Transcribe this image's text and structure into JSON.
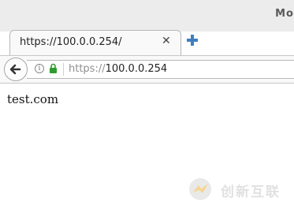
{
  "window": {
    "title": "Mo"
  },
  "tab": {
    "label": "https://100.0.0.254/",
    "close_symbol": "✕"
  },
  "toolbar": {
    "back_icon": "arrow-left-icon",
    "new_tab_icon": "plus-icon"
  },
  "urlbar": {
    "info_icon": "info-icon",
    "lock_icon": "lock-icon",
    "scheme": "https://",
    "host": "100.0.0.254",
    "lock_color": "#2e9b2e"
  },
  "page": {
    "text": "test.com"
  },
  "watermark": {
    "text": "创新互联"
  }
}
